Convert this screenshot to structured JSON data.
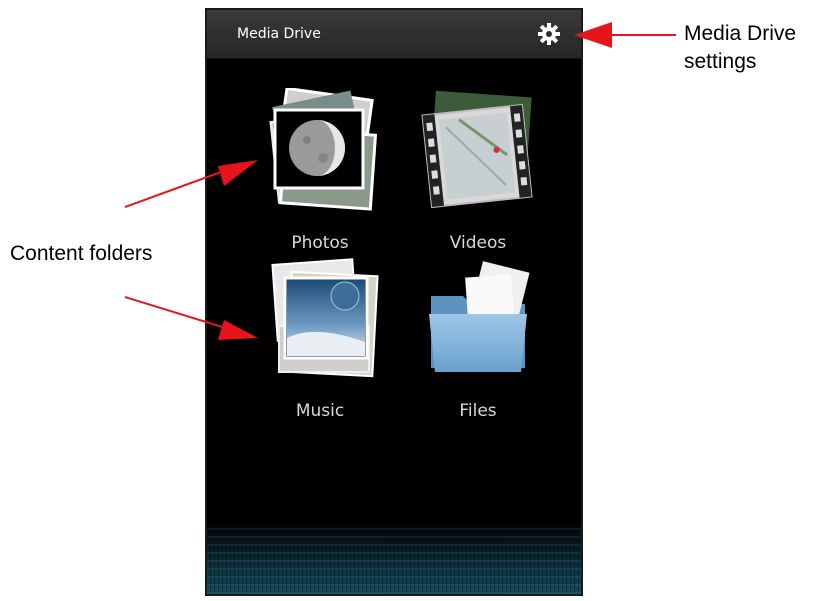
{
  "app": {
    "title": "Media Drive",
    "settings_icon": "gear-icon"
  },
  "folders": [
    {
      "label": "Photos",
      "icon": "photos-stack-icon"
    },
    {
      "label": "Videos",
      "icon": "videos-filmstrip-icon"
    },
    {
      "label": "Music",
      "icon": "music-album-stack-icon"
    },
    {
      "label": "Files",
      "icon": "folder-icon"
    }
  ],
  "annotations": {
    "settings_line1": "Media Drive",
    "settings_line2": "settings",
    "content_folders": "Content folders",
    "arrow_color": "#e8141c"
  }
}
